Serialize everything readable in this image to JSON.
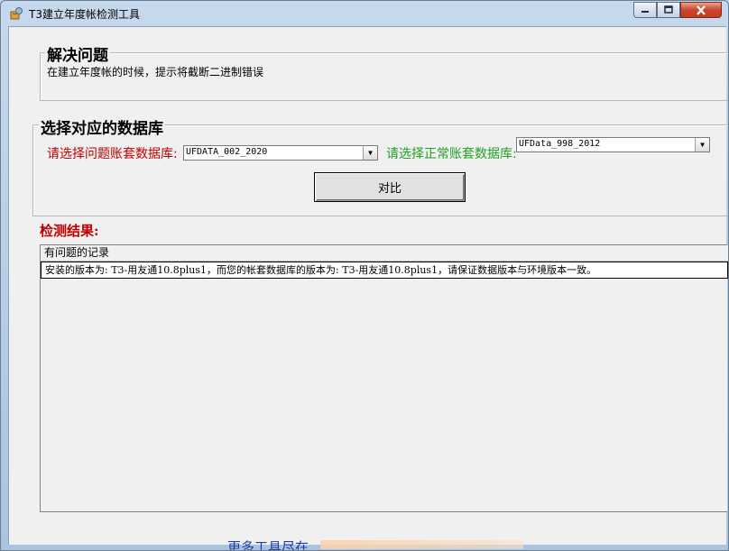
{
  "window": {
    "title": "T3建立年度帐检测工具",
    "controls": {
      "minimize": "minimize",
      "maximize": "maximize",
      "close": "close"
    }
  },
  "problem_group": {
    "title": "解决问题",
    "description": "在建立年度帐的时候，提示将截断二进制错误"
  },
  "db_group": {
    "title": "选择对应的数据库",
    "problem_db_label": "请选择问题账套数据库:",
    "problem_db_value": "UFDATA_002_2020",
    "normal_db_label": "请选择正常账套数据库:",
    "normal_db_value": "UFData_998_2012",
    "compare_button": "对比"
  },
  "results": {
    "title": "检测结果:",
    "header": "有问题的记录",
    "rows": [
      "安装的版本为: T3-用友通10.8plus1，而您的帐套数据库的版本为: T3-用友通10.8plus1，请保证数据版本与环境版本一致。"
    ]
  },
  "footer": {
    "text": "更多工具尽在"
  },
  "colors": {
    "label_red": "#c00000",
    "label_green": "#22a022",
    "link_blue": "#1a3fa6"
  }
}
